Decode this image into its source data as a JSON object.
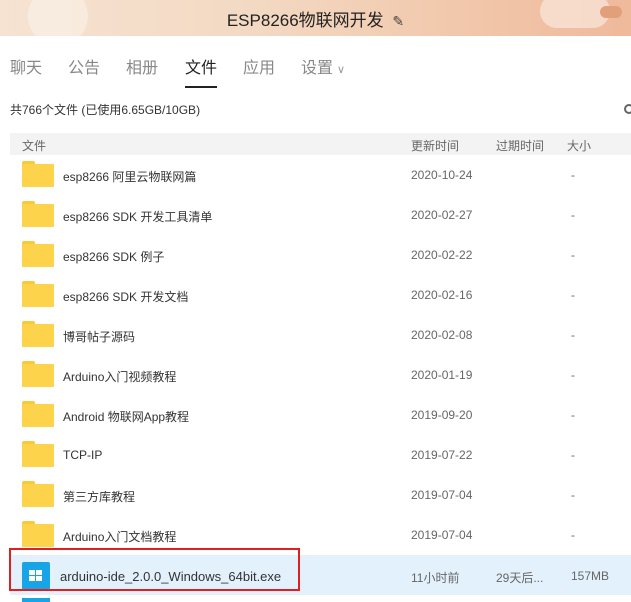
{
  "window": {
    "title": "ESP8266物联网开发",
    "edit_icon": "✎"
  },
  "tabs": [
    {
      "label": "聊天"
    },
    {
      "label": "公告"
    },
    {
      "label": "相册"
    },
    {
      "label": "文件",
      "active": true
    },
    {
      "label": "应用"
    },
    {
      "label": "设置",
      "chevron": "∨"
    }
  ],
  "summary": "共766个文件 (已使用6.65GB/10GB)",
  "columns": {
    "name": "文件",
    "updated": "更新时间",
    "expires": "过期时间",
    "size": "大小"
  },
  "rows": [
    {
      "icon": "folder-icon",
      "name": "esp8266 阿里云物联网篇",
      "updated": "2020-10-24",
      "expires": "",
      "size": "-"
    },
    {
      "icon": "folder-icon",
      "name": "esp8266 SDK 开发工具清单",
      "updated": "2020-02-27",
      "expires": "",
      "size": "-"
    },
    {
      "icon": "folder-icon",
      "name": "esp8266 SDK 例子",
      "updated": "2020-02-22",
      "expires": "",
      "size": "-"
    },
    {
      "icon": "folder-icon",
      "name": "esp8266 SDK 开发文档",
      "updated": "2020-02-16",
      "expires": "",
      "size": "-"
    },
    {
      "icon": "folder-icon",
      "name": "博哥帖子源码",
      "updated": "2020-02-08",
      "expires": "",
      "size": "-"
    },
    {
      "icon": "folder-icon",
      "name": "Arduino入门视频教程",
      "updated": "2020-01-19",
      "expires": "",
      "size": "-"
    },
    {
      "icon": "folder-icon",
      "name": "Android 物联网App教程",
      "updated": "2019-09-20",
      "expires": "",
      "size": "-"
    },
    {
      "icon": "folder-icon",
      "name": "TCP-IP",
      "updated": "2019-07-22",
      "expires": "",
      "size": "-"
    },
    {
      "icon": "folder-icon",
      "name": "第三方库教程",
      "updated": "2019-07-04",
      "expires": "",
      "size": "-"
    },
    {
      "icon": "folder-icon",
      "name": "Arduino入门文档教程",
      "updated": "2019-07-04",
      "expires": "",
      "size": "-"
    },
    {
      "icon": "windows-exe-icon",
      "name": "arduino-ide_2.0.0_Windows_64bit.exe",
      "updated": "11小时前",
      "expires": "29天后...",
      "size": "157MB",
      "selected": true
    }
  ],
  "colors": {
    "selected_row": "#e3f1fd",
    "folder": "#fdd34b",
    "exe_icon": "#17a5e8",
    "highlight_border": "#e02020"
  }
}
